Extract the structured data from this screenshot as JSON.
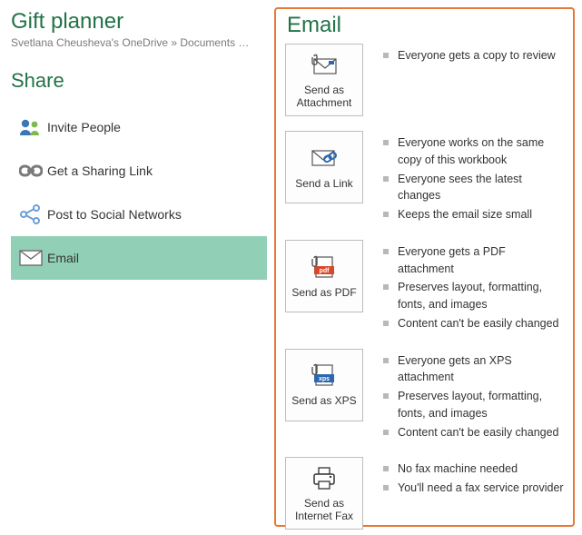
{
  "document_title": "Gift planner",
  "breadcrumb": "Svetlana Cheusheva's OneDrive » Documents » G...",
  "share_heading": "Share",
  "share_items": [
    {
      "label": "Invite People",
      "selected": false,
      "name": "share-invite-people"
    },
    {
      "label": "Get a Sharing Link",
      "selected": false,
      "name": "share-get-link"
    },
    {
      "label": "Post to Social Networks",
      "selected": false,
      "name": "share-social"
    },
    {
      "label": "Email",
      "selected": true,
      "name": "share-email"
    }
  ],
  "right_heading": "Email",
  "options": [
    {
      "name": "send-as-attachment-button",
      "label": "Send as Attachment",
      "icon": "attachment-envelope-icon",
      "bullets": [
        "Everyone gets a copy to review"
      ]
    },
    {
      "name": "send-a-link-button",
      "label": "Send a Link",
      "icon": "envelope-link-icon",
      "bullets": [
        "Everyone works on the same copy of this workbook",
        "Everyone sees the latest changes",
        "Keeps the email size small"
      ]
    },
    {
      "name": "send-as-pdf-button",
      "label": "Send as PDF",
      "icon": "pdf-attachment-icon",
      "bullets": [
        "Everyone gets a PDF attachment",
        "Preserves layout, formatting, fonts, and images",
        "Content can't be easily changed"
      ]
    },
    {
      "name": "send-as-xps-button",
      "label": "Send as XPS",
      "icon": "xps-attachment-icon",
      "bullets": [
        "Everyone gets an XPS attachment",
        "Preserves layout, formatting, fonts, and images",
        "Content can't be easily changed"
      ]
    },
    {
      "name": "send-as-fax-button",
      "label": "Send as Internet Fax",
      "icon": "fax-icon",
      "bullets": [
        "No fax machine needed",
        "You'll need a fax service provider"
      ]
    }
  ]
}
